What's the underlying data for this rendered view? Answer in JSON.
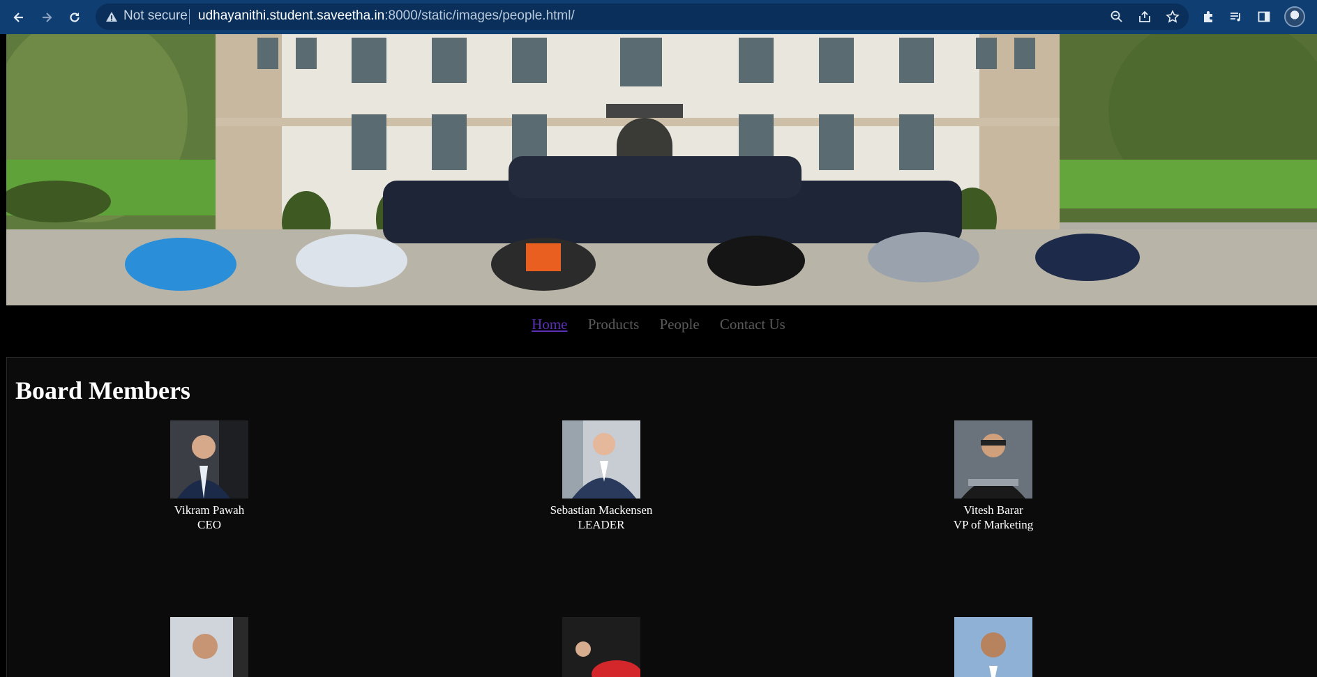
{
  "browser": {
    "security_label": "Not secure",
    "url_host": "udhayanithi.student.saveetha.in",
    "url_rest": ":8000/static/images/people.html/",
    "icons": [
      "back-icon",
      "forward-icon",
      "reload-icon",
      "warning-icon",
      "zoom-icon",
      "share-icon",
      "star-icon",
      "extensions-icon",
      "media-icon",
      "side-panel-icon",
      "profile-avatar"
    ]
  },
  "nav": {
    "items": [
      {
        "label": "Home",
        "active": true
      },
      {
        "label": "Products",
        "active": false
      },
      {
        "label": "People",
        "active": false
      },
      {
        "label": "Contact Us",
        "active": false
      }
    ]
  },
  "section": {
    "title": "Board Members"
  },
  "members": [
    {
      "name": "Vikram Pawah",
      "role": "CEO"
    },
    {
      "name": "Sebastian Mackensen",
      "role": "LEADER"
    },
    {
      "name": "Vitesh Barar",
      "role": "VP of Marketing"
    },
    {
      "name": "",
      "role": ""
    },
    {
      "name": "",
      "role": ""
    },
    {
      "name": "",
      "role": ""
    }
  ],
  "colors": {
    "chrome_bg": "#0f3e73",
    "page_bg": "#000000",
    "content_bg": "#0b0b0b",
    "nav_active": "#5b2fb8",
    "nav_inactive": "#5a5a5a"
  }
}
